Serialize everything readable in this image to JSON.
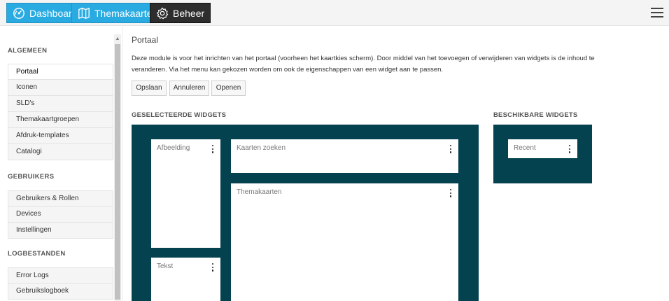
{
  "topbar": {
    "buttons": [
      {
        "label": "Dashboard",
        "icon": "dashboard-gauge-icon",
        "color": "#29abe2"
      },
      {
        "label": "Themakaarten",
        "icon": "map-icon",
        "color": "#29abe2"
      },
      {
        "label": "Beheer",
        "icon": "gear-icon",
        "color": "#2d2d2d"
      }
    ],
    "menu_icon": "hamburger-menu-icon"
  },
  "sidebar": {
    "sections": [
      {
        "title": "ALGEMEEN",
        "items": [
          "Portaal",
          "Iconen",
          "SLD's",
          "Themakaartgroepen",
          "Afdruk-templates",
          "Catalogi"
        ]
      },
      {
        "title": "GEBRUIKERS",
        "items": [
          "Gebruikers & Rollen",
          "Devices",
          "Instellingen"
        ]
      },
      {
        "title": "LOGBESTANDEN",
        "items": [
          "Error Logs",
          "Gebruikslogboek"
        ]
      }
    ],
    "active_item": "Portaal"
  },
  "main": {
    "title": "Portaal",
    "description": "Deze module is voor het inrichten van het portaal (voorheen het kaartkies scherm). Door middel van het toevoegen of verwijderen van widgets is de inhoud te veranderen. Via het menu kan gekozen worden om ook de eigenschappen van een widget aan te passen.",
    "buttons": {
      "save": "Opslaan",
      "cancel": "Annuleren",
      "open": "Openen"
    },
    "selected_widgets": {
      "label": "GESELECTEERDE WIDGETS",
      "widgets": [
        "Afbeelding",
        "Kaarten zoeken",
        "Themakaarten",
        "Tekst"
      ]
    },
    "available_widgets": {
      "label": "BESCHIKBARE WIDGETS",
      "widgets": [
        "Recent"
      ]
    },
    "colors": {
      "panel": "#04424f",
      "accent": "#29abe2"
    }
  }
}
